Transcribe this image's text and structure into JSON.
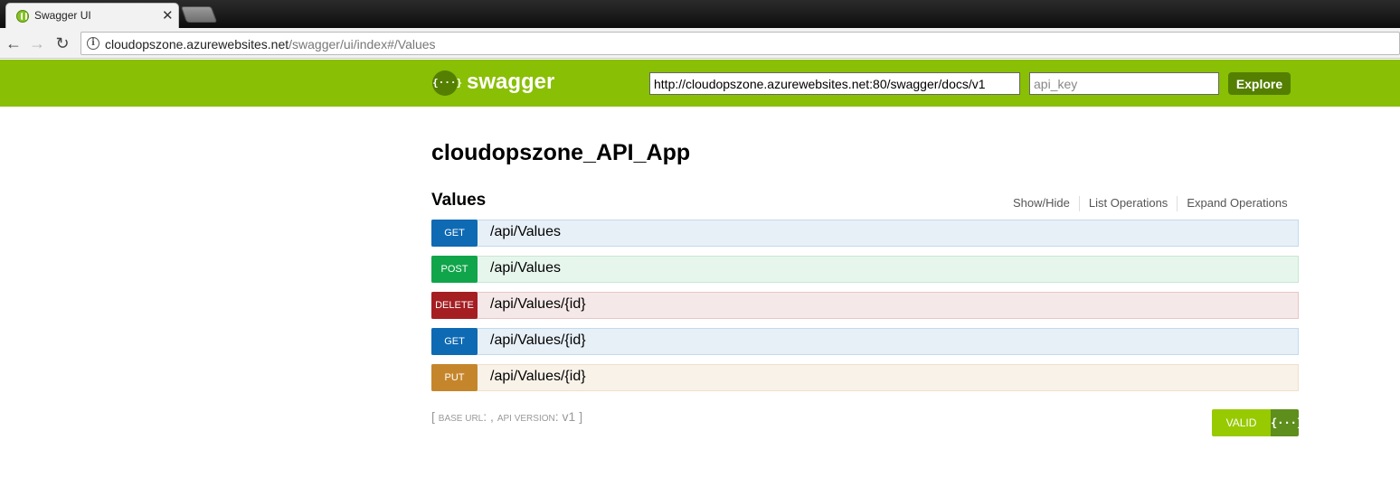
{
  "browser": {
    "tab_title": "Swagger UI",
    "tab_close": "✕",
    "url_host": "cloudopszone.azurewebsites.net",
    "url_path": "/swagger/ui/index#/Values",
    "info_icon": "i"
  },
  "swagger": {
    "logo_icon": "{···}",
    "logo_text": "swagger",
    "spec_url": "http://cloudopszone.azurewebsites.net:80/swagger/docs/v1",
    "api_key_placeholder": "api_key",
    "explore_label": "Explore"
  },
  "api": {
    "title": "cloudopszone_API_App",
    "resource": {
      "name": "Values",
      "links": [
        "Show/Hide",
        "List Operations",
        "Expand Operations"
      ],
      "operations": [
        {
          "method": "GET",
          "path": "/api/Values"
        },
        {
          "method": "POST",
          "path": "/api/Values"
        },
        {
          "method": "DELETE",
          "path": "/api/Values/{id}"
        },
        {
          "method": "GET",
          "path": "/api/Values/{id}"
        },
        {
          "method": "PUT",
          "path": "/api/Values/{id}"
        }
      ]
    },
    "footer": {
      "open_bracket": "[",
      "base_url_label": "base url",
      "base_url_value": ": ,",
      "api_version_label": "api version",
      "api_version_value": ": v1",
      "close_bracket": "]"
    },
    "validator": {
      "label": "VALID",
      "icon": "{···}"
    }
  },
  "colors": {
    "header": "#89bf04",
    "get": "#0f6ab4",
    "post": "#10a54a",
    "delete": "#a41e22",
    "put": "#c5862b"
  }
}
